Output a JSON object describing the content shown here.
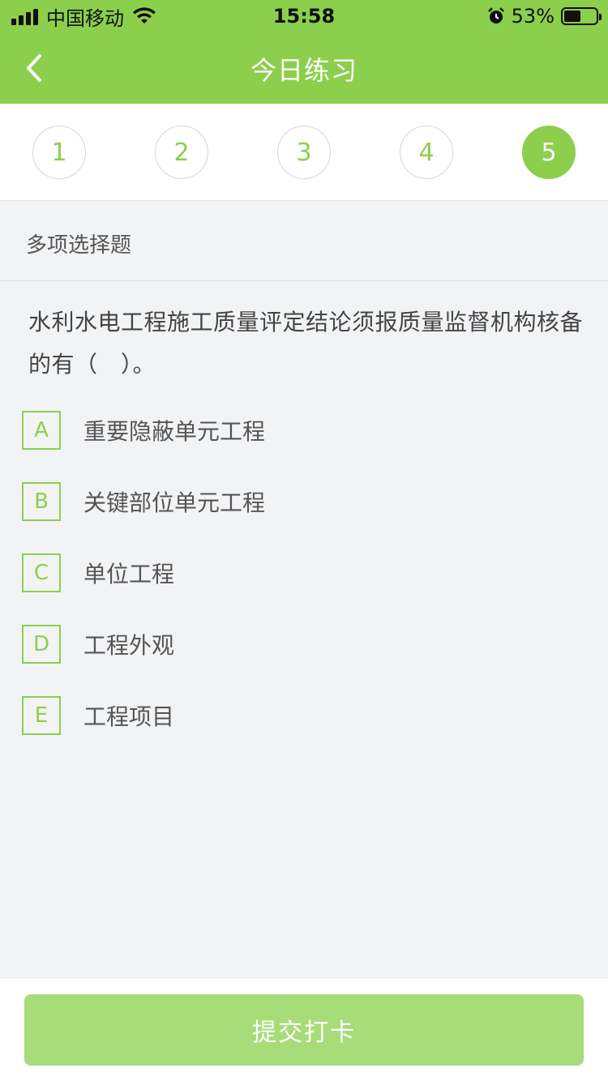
{
  "status_bar": {
    "carrier": "中国移动",
    "time": "15:58",
    "battery_percent": "53%",
    "battery_level": 0.53,
    "icons": [
      "signal-icon",
      "wifi-icon",
      "alarm-icon",
      "battery-icon"
    ]
  },
  "nav": {
    "title": "今日练习",
    "back_icon": "chevron-left-icon"
  },
  "tabs": [
    {
      "label": "1",
      "active": false
    },
    {
      "label": "2",
      "active": false
    },
    {
      "label": "3",
      "active": false
    },
    {
      "label": "4",
      "active": false
    },
    {
      "label": "5",
      "active": true
    }
  ],
  "question": {
    "type": "多项选择题",
    "text": "水利水电工程施工质量评定结论须报质量监督机构核备的有（　）。",
    "options": [
      {
        "letter": "A",
        "text": "重要隐蔽单元工程"
      },
      {
        "letter": "B",
        "text": "关键部位单元工程"
      },
      {
        "letter": "C",
        "text": "单位工程"
      },
      {
        "letter": "D",
        "text": "工程外观"
      },
      {
        "letter": "E",
        "text": "工程项目"
      }
    ]
  },
  "footer": {
    "submit_label": "提交打卡"
  },
  "colors": {
    "accent": "#8ccf4d",
    "submit_bg": "#a8dc78",
    "page_bg": "#f2f3f5"
  }
}
